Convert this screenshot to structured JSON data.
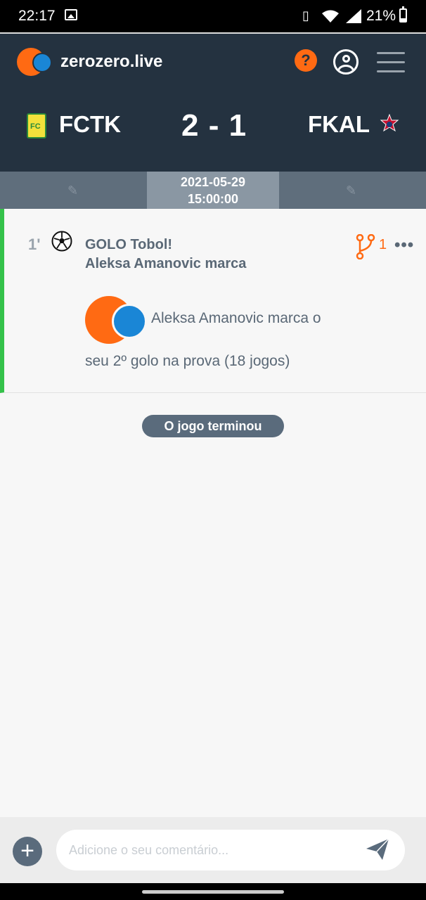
{
  "status_bar": {
    "time": "22:17",
    "battery_pct": "21%"
  },
  "header": {
    "brand": "zerozero.live",
    "help_label": "?"
  },
  "match": {
    "home": "FCTK",
    "score": "2 - 1",
    "away": "FKAL"
  },
  "datebar": {
    "date": "2021-05-29",
    "time": "15:00:00"
  },
  "event": {
    "minute": "1'",
    "title_line1": "GOLO Tobol!",
    "title_line2": "Aleksa Amanovic marca",
    "branch_count": "1",
    "more": "•••",
    "desc_line1": "Aleksa Amanovic marca o",
    "desc_line2": "seu 2º golo na prova (18 jogos)"
  },
  "ended_label": "O jogo terminou",
  "composer": {
    "placeholder": "Adicione o seu comentário...",
    "add_label": "+"
  },
  "colors": {
    "accent": "#ff6a13",
    "brand_blue": "#1a86d6",
    "header_bg": "#243240",
    "goal_green": "#35c24a"
  }
}
